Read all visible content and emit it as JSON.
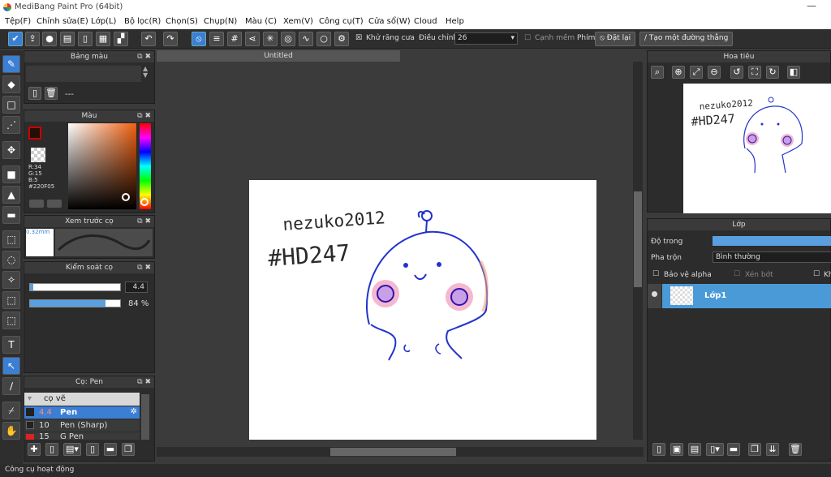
{
  "app": {
    "title": "MediBang Paint Pro (64bit)",
    "minimize": "—"
  },
  "menu": [
    "Tệp(F)",
    "Chỉnh sửa(E)",
    "Lớp(L)",
    "Bộ lọc(R)",
    "Chọn(S)",
    "Chụp(N)",
    "Màu (C)",
    "Xem(V)",
    "Công cụ(T)",
    "Cửa sổ(W)",
    "Cloud",
    "Help"
  ],
  "toolbar": {
    "antialias_label": "Khử răng cưa",
    "adjust_label": "Điều chỉnh",
    "adjust_value": "26",
    "soft_edge_label": "Cạnh mềm",
    "key_label": "Phím",
    "reset_label": "Đặt lại",
    "straight_line_label": "Tạo một đường thẳng"
  },
  "palette": {
    "title": "Bảng màu",
    "value": "---"
  },
  "color": {
    "title": "Màu",
    "r": "R:34",
    "g": "G:15",
    "b": "B:5",
    "hex": "#220F05"
  },
  "brush_preview": {
    "title": "Xem trước cọ",
    "size": "0.32mm"
  },
  "brush_control": {
    "title": "Kiểm soát cọ",
    "size_value": "4.4",
    "size_fill": 0.04,
    "opacity_value": "84 %",
    "opacity_fill": 0.84
  },
  "brush_list": {
    "title": "Cọ: Pen",
    "group": "cọ vẽ",
    "items": [
      {
        "size": "4.4",
        "name": "Pen",
        "selected": true
      },
      {
        "size": "10",
        "name": "Pen (Sharp)",
        "selected": false
      },
      {
        "size": "15",
        "name": "G Pen",
        "selected": false
      }
    ]
  },
  "canvas": {
    "tab": "Untitled"
  },
  "navigator": {
    "title": "Hoa tiêu"
  },
  "layers": {
    "title": "Lớp",
    "opacity_label": "Độ trong",
    "blend_label": "Pha trộn",
    "blend_value": "Bình thường",
    "protect_alpha": "Bảo vệ alpha",
    "clipping": "Xén bớt",
    "lock_short": "Kh",
    "layer_name": "Lớp1"
  },
  "drawing_text": {
    "line1": "nezuko2012",
    "line2": "#HD247"
  },
  "status": {
    "text": "Công cụ hoạt động"
  }
}
